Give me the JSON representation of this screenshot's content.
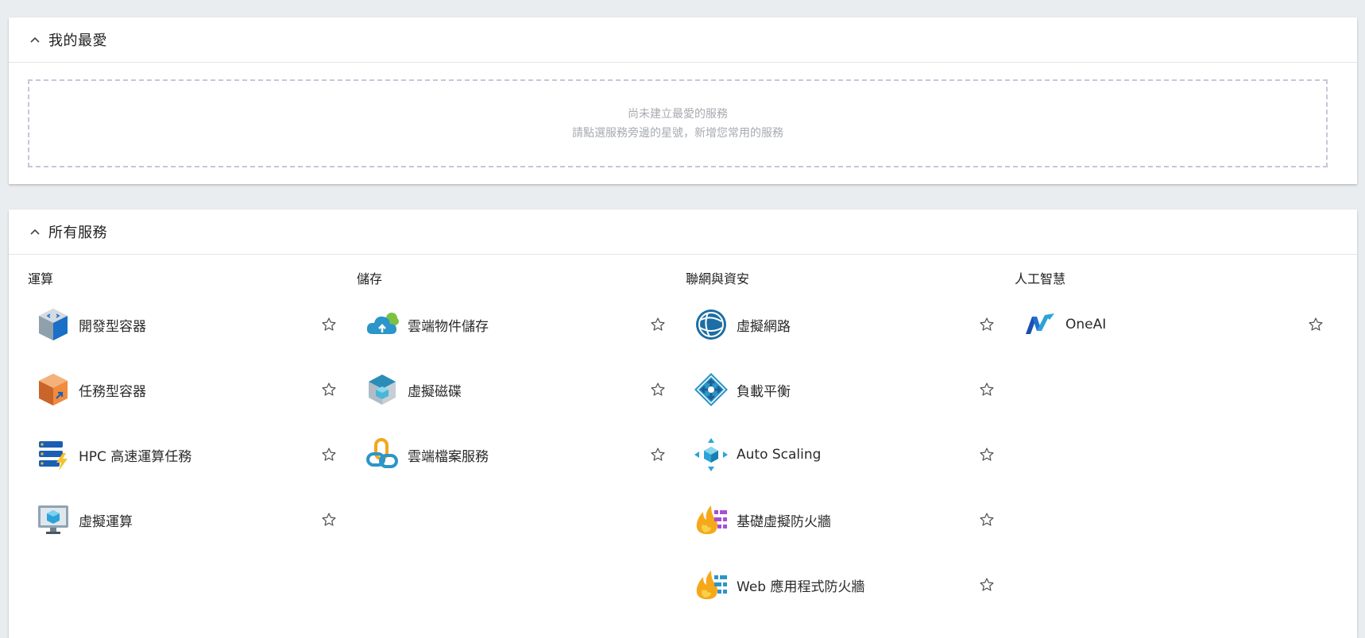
{
  "favorites": {
    "title": "我的最愛",
    "empty_line1": "尚未建立最愛的服務",
    "empty_line2": "請點選服務旁邊的星號，新增您常用的服務"
  },
  "all_services": {
    "title": "所有服務",
    "categories": [
      {
        "title": "運算",
        "items": [
          {
            "label": "開發型容器",
            "icon": "dev-container-icon"
          },
          {
            "label": "任務型容器",
            "icon": "job-container-icon"
          },
          {
            "label": "HPC 高速運算任務",
            "icon": "hpc-icon"
          },
          {
            "label": "虛擬運算",
            "icon": "virtual-compute-icon"
          }
        ]
      },
      {
        "title": "儲存",
        "items": [
          {
            "label": "雲端物件儲存",
            "icon": "cloud-object-storage-icon"
          },
          {
            "label": "虛擬磁碟",
            "icon": "virtual-disk-icon"
          },
          {
            "label": "雲端檔案服務",
            "icon": "cloud-file-service-icon"
          }
        ]
      },
      {
        "title": "聯網與資安",
        "items": [
          {
            "label": "虛擬網路",
            "icon": "virtual-network-icon"
          },
          {
            "label": "負載平衡",
            "icon": "load-balancer-icon"
          },
          {
            "label": "Auto Scaling",
            "icon": "auto-scaling-icon"
          },
          {
            "label": "基礎虛擬防火牆",
            "icon": "basic-firewall-icon"
          },
          {
            "label": "Web 應用程式防火牆",
            "icon": "web-app-firewall-icon"
          }
        ]
      },
      {
        "title": "人工智慧",
        "items": [
          {
            "label": "OneAI",
            "icon": "oneai-icon"
          }
        ]
      }
    ]
  },
  "colors": {
    "background": "#eaedf0",
    "panel": "#ffffff",
    "dashed_border": "#c4c8db",
    "muted_text": "#a7aab0",
    "star_outline": "#555555"
  }
}
